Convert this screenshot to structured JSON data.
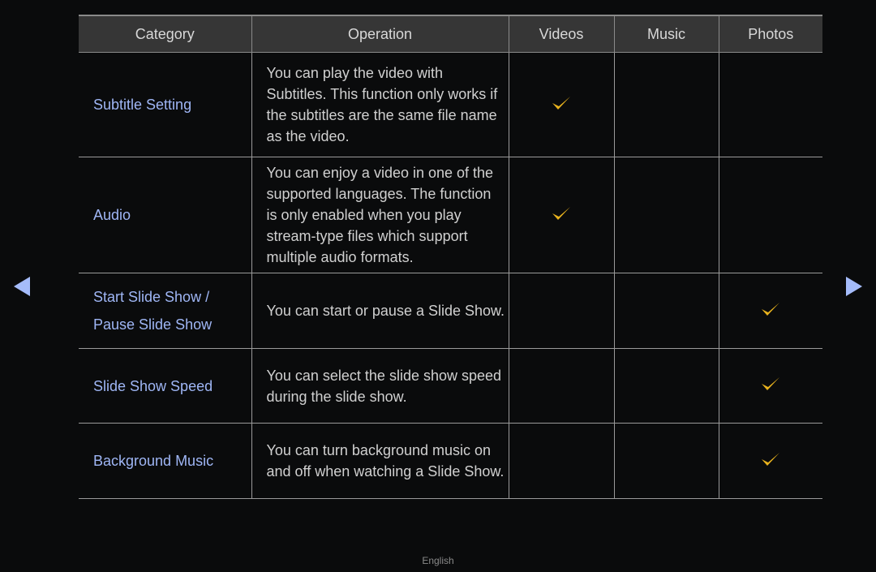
{
  "table": {
    "headers": [
      "Category",
      "Operation",
      "Videos",
      "Music",
      "Photos"
    ],
    "rows": [
      {
        "category": "Subtitle Setting",
        "operation": "You can play the video with Subtitles. This function only works if the subtitles are the same file name as the video.",
        "videos": true,
        "music": false,
        "photos": false
      },
      {
        "category": "Audio",
        "operation": "You can enjoy a video in one of the supported languages. The function is only enabled when you play stream-type files which support multiple audio formats.",
        "videos": true,
        "music": false,
        "photos": false
      },
      {
        "category_lines": [
          "Start Slide Show /",
          "Pause Slide Show"
        ],
        "category": "Start Slide Show / Pause Slide Show",
        "operation": "You can start or pause a Slide Show.",
        "videos": false,
        "music": false,
        "photos": true
      },
      {
        "category": "Slide Show Speed",
        "operation": "You can select the slide show speed during the slide show.",
        "videos": false,
        "music": false,
        "photos": true
      },
      {
        "category": "Background Music",
        "operation": "You can turn background music on and off when watching a Slide Show.",
        "videos": false,
        "music": false,
        "photos": true
      }
    ]
  },
  "navigation": {
    "prev_icon": "triangle-left-icon",
    "next_icon": "triangle-right-icon"
  },
  "footer": {
    "language": "English"
  },
  "colors": {
    "background": "#0a0b0c",
    "header_bg": "#363636",
    "category_text": "#9fb6f5",
    "check": "#e8b21e",
    "arrow": "#a5bcfa"
  }
}
